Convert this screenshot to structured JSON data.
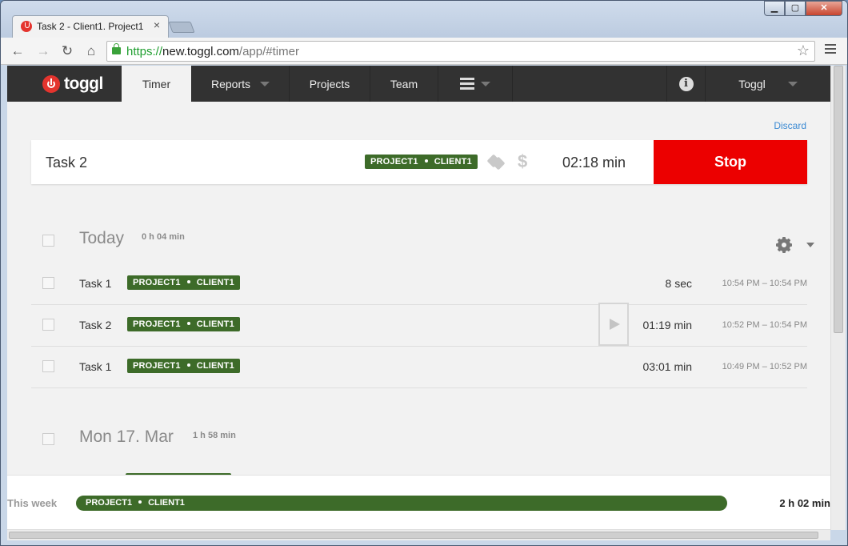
{
  "browser": {
    "tab_title": "Task 2 - Client1. Project1",
    "tab_close": "×",
    "url_scheme": "https://",
    "url_host": "new.toggl.com",
    "url_path": "/app/#timer",
    "window_buttons": {
      "minimize": "▁",
      "maximize": "▢",
      "close": "✕"
    }
  },
  "nav": {
    "logo": "toggl",
    "items": [
      {
        "label": "Timer",
        "active": true
      },
      {
        "label": "Reports"
      },
      {
        "label": "Projects"
      },
      {
        "label": "Team"
      }
    ],
    "info_icon": "i",
    "user": "Toggl"
  },
  "timer": {
    "discard_label": "Discard",
    "description": "Task 2",
    "project": "PROJECT1",
    "client": "CLIENT1",
    "dollar": "$",
    "duration": "02:18 min",
    "stop_label": "Stop"
  },
  "days": [
    {
      "title": "Today",
      "total": "0 h 04 min",
      "entries": [
        {
          "description": "Task 1",
          "project": "PROJECT1",
          "client": "CLIENT1",
          "duration": "8 sec",
          "time_range": "10:54 PM – 10:54 PM"
        },
        {
          "description": "Task 2",
          "project": "PROJECT1",
          "client": "CLIENT1",
          "duration": "01:19 min",
          "time_range": "10:52 PM – 10:54 PM"
        },
        {
          "description": "Task 1",
          "project": "PROJECT1",
          "client": "CLIENT1",
          "duration": "03:01 min",
          "time_range": "10:49 PM – 10:52 PM"
        }
      ]
    },
    {
      "title": "Mon 17. Mar",
      "total": "1 h 58 min"
    }
  ],
  "footer": {
    "week_label": "This week",
    "project": "PROJECT1",
    "client": "CLIENT1",
    "total": "2 h 02 min"
  },
  "colors": {
    "stop_button": "#ec0000",
    "project_tag": "#3d6b29",
    "nav_bg": "#323232",
    "link": "#3b8ad3"
  }
}
